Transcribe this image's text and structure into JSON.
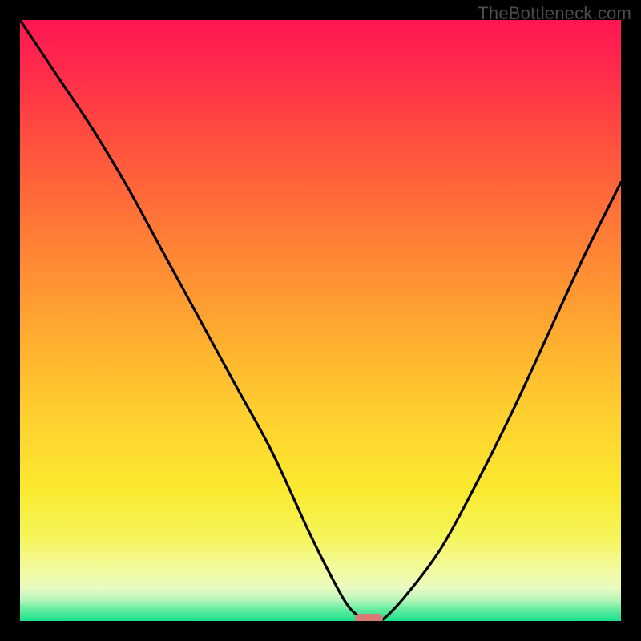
{
  "attribution": "TheBottleneck.com",
  "chart_data": {
    "type": "line",
    "title": "",
    "xlabel": "",
    "ylabel": "",
    "xlim": [
      0,
      100
    ],
    "ylim": [
      0,
      100
    ],
    "x": [
      0,
      6,
      12,
      18,
      24,
      30,
      36,
      42,
      48,
      52,
      55,
      58,
      60,
      64,
      70,
      76,
      82,
      88,
      94,
      100
    ],
    "values": [
      100,
      91,
      82,
      72,
      61,
      50,
      39,
      28,
      15,
      7,
      2,
      0,
      0,
      4,
      12,
      23,
      35,
      48,
      61,
      73
    ],
    "note": "V-shaped bottleneck curve; minimum near x≈58; percentage-style axes with no ticks drawn.",
    "marker": {
      "x": 58,
      "y": 0
    },
    "background_gradient_stops": [
      {
        "offset": 0.0,
        "color": "#ff1553"
      },
      {
        "offset": 0.08,
        "color": "#ff2a4b"
      },
      {
        "offset": 0.2,
        "color": "#ff4f3e"
      },
      {
        "offset": 0.35,
        "color": "#ff7a36"
      },
      {
        "offset": 0.5,
        "color": "#ffa531"
      },
      {
        "offset": 0.65,
        "color": "#ffce2f"
      },
      {
        "offset": 0.78,
        "color": "#fbe92f"
      },
      {
        "offset": 0.86,
        "color": "#f5f55a"
      },
      {
        "offset": 0.91,
        "color": "#f4fa9a"
      },
      {
        "offset": 0.945,
        "color": "#e8fbc0"
      },
      {
        "offset": 0.965,
        "color": "#b6f6ba"
      },
      {
        "offset": 0.98,
        "color": "#67eca0"
      },
      {
        "offset": 1.0,
        "color": "#18e18e"
      }
    ]
  }
}
